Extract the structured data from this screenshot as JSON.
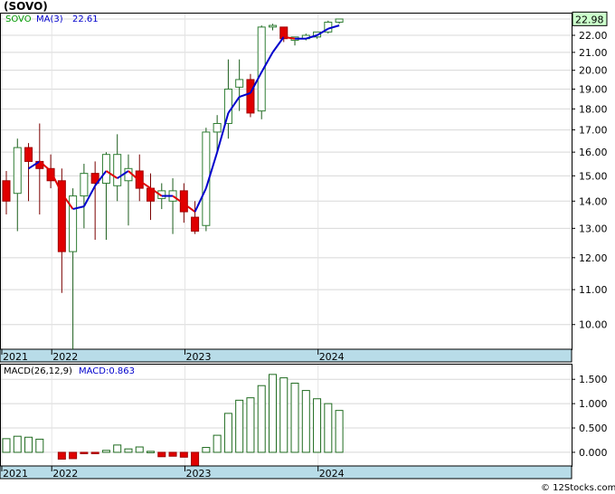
{
  "ticker_title": "(SOVO)",
  "watermark": "© 12Stocks.com",
  "colors": {
    "up": "#2e7d32",
    "down": "#e00000",
    "ma_up": "#0000cc",
    "ma_down": "#e00000",
    "macd_bar": "#1f6b1f",
    "axis_band": "#b8dce8",
    "last_price_box": "#ccffcc"
  },
  "chart_data": [
    {
      "type": "candlestick",
      "title": "(SOVO)",
      "legend": {
        "symbol": "SOVO",
        "ma_label": "MA(3)",
        "ma_value": "22.61"
      },
      "last_price_label": "22.98",
      "ylim": [
        9.35,
        23.4
      ],
      "y_scale": "log",
      "y_ticks": [
        "10.00",
        "11.00",
        "12.00",
        "13.00",
        "14.00",
        "15.00",
        "16.00",
        "17.00",
        "18.00",
        "19.00",
        "20.00",
        "21.00",
        "22.00",
        "23.00"
      ],
      "x_labels": [
        {
          "label": "2021",
          "index": 0
        },
        {
          "label": "2022",
          "index": 4.5
        },
        {
          "label": "2023",
          "index": 16.5
        },
        {
          "label": "2024",
          "index": 28.5
        }
      ],
      "ohlc": [
        {
          "o": 14.8,
          "h": 15.2,
          "l": 13.5,
          "c": 14.0
        },
        {
          "o": 14.3,
          "h": 16.6,
          "l": 12.9,
          "c": 16.2
        },
        {
          "o": 16.2,
          "h": 16.4,
          "l": 14.0,
          "c": 15.6
        },
        {
          "o": 15.6,
          "h": 17.3,
          "l": 13.5,
          "c": 15.3
        },
        {
          "o": 15.3,
          "h": 15.9,
          "l": 14.5,
          "c": 14.8
        },
        {
          "o": 14.8,
          "h": 15.3,
          "l": 10.9,
          "c": 12.2
        },
        {
          "o": 12.2,
          "h": 14.5,
          "l": 9.35,
          "c": 14.2
        },
        {
          "o": 14.2,
          "h": 15.5,
          "l": 13.0,
          "c": 15.1
        },
        {
          "o": 15.1,
          "h": 15.6,
          "l": 12.6,
          "c": 14.7
        },
        {
          "o": 14.7,
          "h": 16.0,
          "l": 12.6,
          "c": 15.9
        },
        {
          "o": 14.6,
          "h": 16.8,
          "l": 14.0,
          "c": 15.9
        },
        {
          "o": 14.8,
          "h": 15.9,
          "l": 13.1,
          "c": 15.3
        },
        {
          "o": 15.2,
          "h": 15.9,
          "l": 14.0,
          "c": 14.5
        },
        {
          "o": 14.5,
          "h": 15.1,
          "l": 13.3,
          "c": 14.0
        },
        {
          "o": 14.1,
          "h": 14.7,
          "l": 13.7,
          "c": 14.4
        },
        {
          "o": 14.0,
          "h": 14.9,
          "l": 12.8,
          "c": 14.4
        },
        {
          "o": 14.4,
          "h": 14.7,
          "l": 13.2,
          "c": 13.6
        },
        {
          "o": 13.4,
          "h": 14.0,
          "l": 12.8,
          "c": 12.9
        },
        {
          "o": 13.1,
          "h": 17.1,
          "l": 12.9,
          "c": 16.9
        },
        {
          "o": 16.9,
          "h": 17.7,
          "l": 16.0,
          "c": 17.3
        },
        {
          "o": 17.3,
          "h": 20.6,
          "l": 16.6,
          "c": 19.0
        },
        {
          "o": 19.1,
          "h": 20.6,
          "l": 17.9,
          "c": 19.5
        },
        {
          "o": 19.5,
          "h": 19.8,
          "l": 17.6,
          "c": 17.8
        },
        {
          "o": 17.9,
          "h": 22.6,
          "l": 17.5,
          "c": 22.5
        },
        {
          "o": 22.5,
          "h": 22.7,
          "l": 22.3,
          "c": 22.6
        },
        {
          "o": 22.5,
          "h": 22.5,
          "l": 21.6,
          "c": 21.8
        },
        {
          "o": 21.7,
          "h": 21.9,
          "l": 21.4,
          "c": 21.9
        },
        {
          "o": 21.8,
          "h": 22.1,
          "l": 21.7,
          "c": 22.0
        },
        {
          "o": 21.9,
          "h": 22.2,
          "l": 21.8,
          "c": 22.2
        },
        {
          "o": 22.2,
          "h": 22.9,
          "l": 22.1,
          "c": 22.8
        },
        {
          "o": 22.8,
          "h": 23.0,
          "l": 22.7,
          "c": 23.0
        }
      ],
      "ma3": [
        null,
        null,
        15.3,
        15.6,
        15.2,
        14.3,
        13.7,
        13.8,
        14.6,
        15.2,
        14.9,
        15.2,
        14.8,
        14.5,
        14.2,
        14.2,
        13.9,
        13.6,
        14.5,
        16.0,
        17.8,
        18.6,
        18.8,
        19.9,
        21.0,
        21.9,
        21.8,
        21.8,
        22.0,
        22.4,
        22.6
      ]
    },
    {
      "type": "bar",
      "title": "MACD(26,12,9)",
      "legend": {
        "label": "MACD(26,12,9)",
        "value_label": "MACD:0.863"
      },
      "ylim": [
        -0.28,
        1.82
      ],
      "y_ticks": [
        "0.000",
        "0.500",
        "1.000",
        "1.500"
      ],
      "values": [
        0.28,
        0.33,
        0.31,
        0.27,
        null,
        -0.14,
        -0.13,
        -0.02,
        -0.01,
        0.04,
        0.15,
        0.07,
        0.11,
        0.02,
        -0.09,
        -0.08,
        -0.1,
        -0.3,
        0.1,
        0.35,
        0.8,
        1.07,
        1.12,
        1.37,
        1.6,
        1.53,
        1.42,
        1.27,
        1.1,
        1.0,
        0.86
      ]
    }
  ]
}
